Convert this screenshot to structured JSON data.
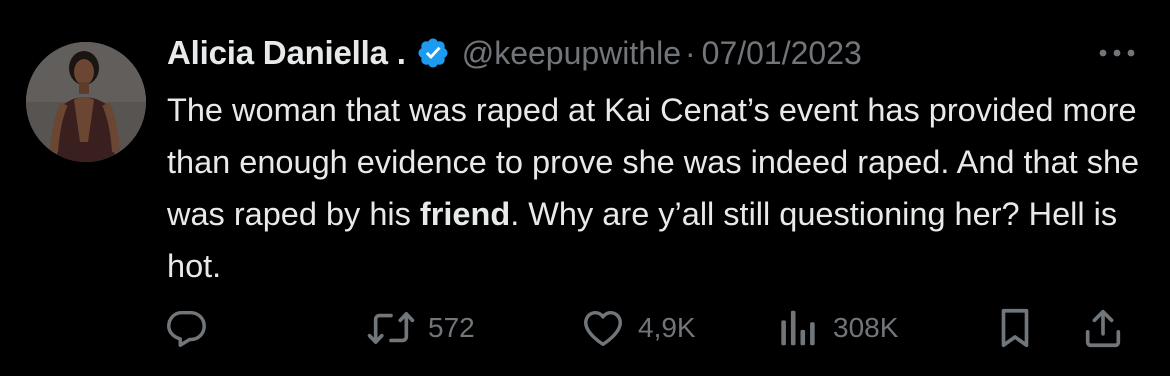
{
  "tweet": {
    "author_name": "Alicia Daniella .",
    "handle": "@keepupwithle",
    "separator": "·",
    "date": "07/01/2023",
    "text_parts": [
      "The woman that was raped at Kai Cenat’s event has provided more than enough evidence to prove she was indeed raped. And that she was raped by his ",
      "friend",
      ". Why are y’all still questioning her? Hell is hot."
    ]
  },
  "actions": {
    "reply_icon": "reply-icon",
    "retweet_count": "572",
    "like_count": "4,9K",
    "views_count": "308K",
    "bookmark_icon": "bookmark-icon",
    "share_icon": "share-icon"
  },
  "colors": {
    "background": "#000000",
    "text_primary": "#e7e9ea",
    "text_secondary": "#71767b",
    "verified_blue": "#1d9bf0"
  }
}
